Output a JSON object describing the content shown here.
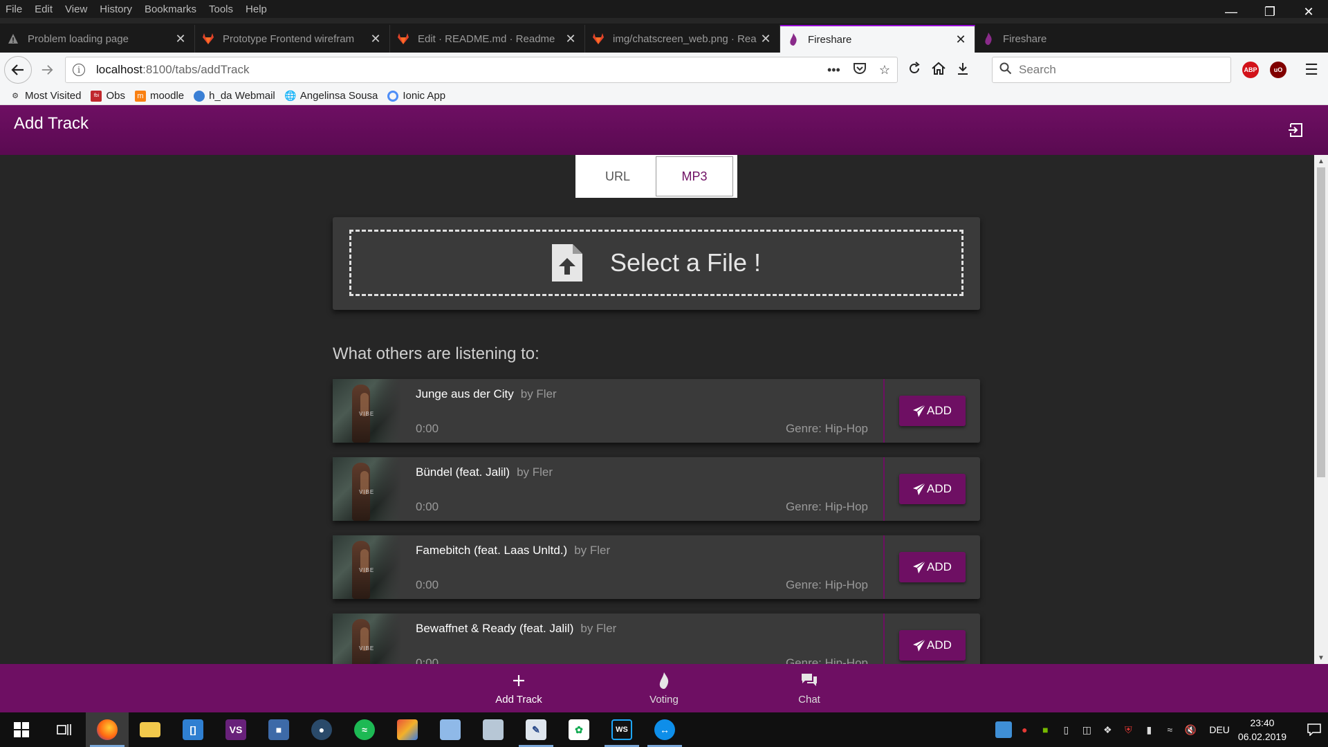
{
  "menubar": {
    "items": [
      "File",
      "Edit",
      "View",
      "History",
      "Bookmarks",
      "Tools",
      "Help"
    ]
  },
  "browser": {
    "tabs": [
      {
        "label": "Problem loading page",
        "icon": "warning-icon"
      },
      {
        "label": "Prototype Frontend wirefram",
        "icon": "gitlab-icon"
      },
      {
        "label": "Edit · README.md · Readme",
        "icon": "gitlab-icon"
      },
      {
        "label": "img/chatscreen_web.png · Rea",
        "icon": "gitlab-icon"
      },
      {
        "label": "Fireshare",
        "icon": "flame-icon"
      },
      {
        "label": "Fireshare",
        "icon": "flame-icon"
      }
    ],
    "url_host": "localhost",
    "url_path": ":8100/tabs/addTrack",
    "search_placeholder": "Search",
    "bookmarks": [
      {
        "label": "Most Visited",
        "icon": "gear-icon"
      },
      {
        "label": "Obs",
        "icon": "obs-icon"
      },
      {
        "label": "moodle",
        "icon": "moodle-icon"
      },
      {
        "label": "h_da Webmail",
        "icon": "mail-icon"
      },
      {
        "label": "Angelinsa Sousa",
        "icon": "globe-icon"
      },
      {
        "label": "Ionic App",
        "icon": "ionic-icon"
      }
    ],
    "extensions": [
      {
        "label": "ABP",
        "color": "#d2121a"
      },
      {
        "label": "uO",
        "color": "#800000"
      }
    ]
  },
  "app": {
    "header_title": "Add Track",
    "segments": [
      {
        "label": "URL",
        "active": false
      },
      {
        "label": "MP3",
        "active": true
      }
    ],
    "dropzone_label": "Select a File !",
    "section_title": "What others are listening to:",
    "tracks": [
      {
        "title": "Junge aus der City",
        "by": "by Fler",
        "time": "0:00",
        "genre": "Genre: Hip-Hop",
        "add": "ADD"
      },
      {
        "title": "Bündel (feat. Jalil)",
        "by": "by Fler",
        "time": "0:00",
        "genre": "Genre: Hip-Hop",
        "add": "ADD"
      },
      {
        "title": "Famebitch (feat. Laas Unltd.)",
        "by": "by Fler",
        "time": "0:00",
        "genre": "Genre: Hip-Hop",
        "add": "ADD"
      },
      {
        "title": "Bewaffnet & Ready (feat. Jalil)",
        "by": "by Fler",
        "time": "0:00",
        "genre": "Genre: Hip-Hop",
        "add": "ADD"
      }
    ],
    "tabbar": [
      {
        "label": "Add Track",
        "icon": "plus-icon",
        "active": true
      },
      {
        "label": "Voting",
        "icon": "flame-icon",
        "active": false
      },
      {
        "label": "Chat",
        "icon": "chat-icon",
        "active": false
      }
    ],
    "accent_color": "#6e0f63"
  },
  "taskbar": {
    "language": "DEU",
    "time": "23:40",
    "date": "06.02.2019"
  }
}
